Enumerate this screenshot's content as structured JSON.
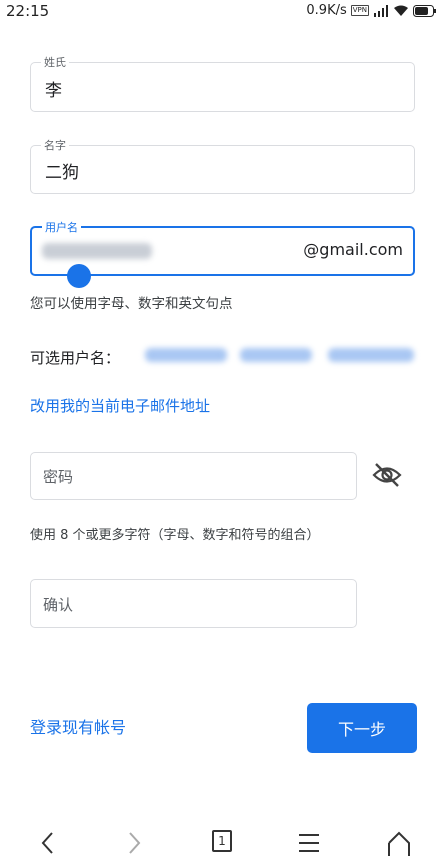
{
  "status_bar": {
    "time": "22:15",
    "speed": "0.9K/s",
    "vpn": "VPN"
  },
  "form": {
    "last_name": {
      "label": "姓氏",
      "value": "李"
    },
    "first_name": {
      "label": "名字",
      "value": "二狗"
    },
    "username": {
      "label": "用户名",
      "suffix": "@gmail.com"
    },
    "username_hint": "您可以使用字母、数字和英文句点",
    "suggestions_label": "可选用户名：",
    "use_current_email_link": "改用我的当前电子邮件地址",
    "password": {
      "placeholder": "密码"
    },
    "password_hint": "使用 8 个或更多字符（字母、数字和符号的组合）",
    "confirm": {
      "placeholder": "确认"
    },
    "sign_in_link": "登录现有帐号",
    "next_button": "下一步"
  },
  "bottom_nav": {
    "tabs_count": "1"
  },
  "colors": {
    "accent": "#1a73e8",
    "border": "#dadce0"
  },
  "icons": [
    "signal-icon",
    "wifi-icon",
    "battery-icon",
    "eye-off-icon",
    "back-icon",
    "forward-icon",
    "tabs-icon",
    "menu-icon",
    "home-icon"
  ]
}
